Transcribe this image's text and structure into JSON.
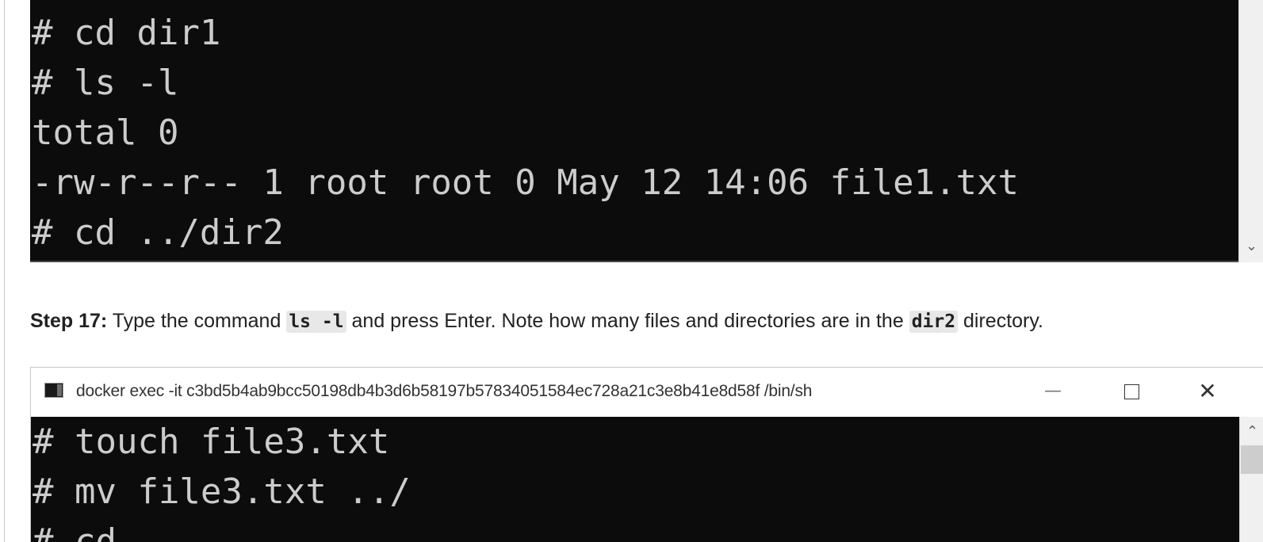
{
  "top_terminal": {
    "lines": [
      "# cd dir1",
      "# ls -l",
      "total 0",
      "-rw-r--r-- 1 root root 0 May 12 14:06 file1.txt",
      "# cd ../dir2"
    ],
    "scroll_down_glyph": "⌄"
  },
  "instruction": {
    "step_label": "Step 17:",
    "text_1": " Type the command ",
    "code_1": "ls -l",
    "text_2": " and press Enter. Note how many files and directories are in the ",
    "code_2": "dir2",
    "text_3": " directory."
  },
  "window": {
    "title": "docker  exec -it c3bd5b4ab9bcc50198db4b3d6b58197b57834051584ec728a21c3e8b41e8d58f /bin/sh",
    "minimize_glyph": "—",
    "close_glyph": "✕",
    "scroll_up_glyph": "⌃",
    "lines": [
      "# touch file3.txt",
      "# mv file3.txt ../",
      "# cd .."
    ]
  },
  "colors": {
    "terminal_bg": "#0c0c0c",
    "terminal_fg": "#cccccc",
    "code_bg": "#e8e8e8"
  }
}
